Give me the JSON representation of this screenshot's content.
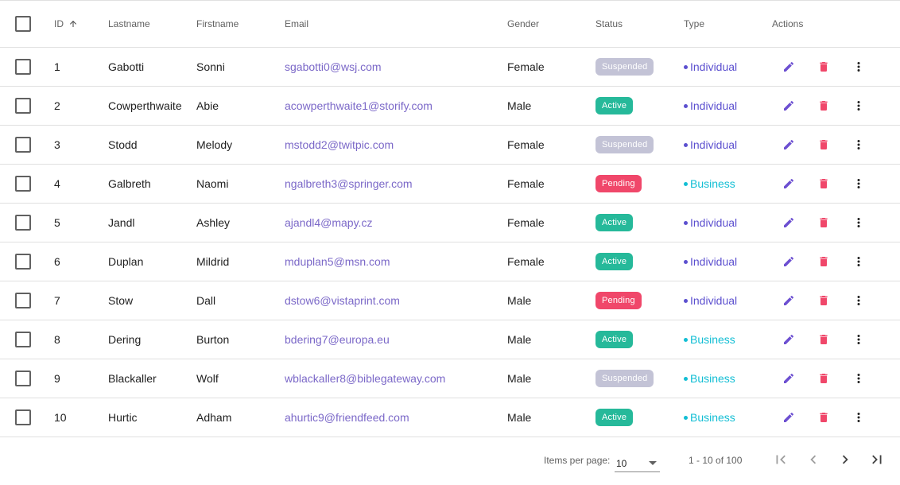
{
  "columns": {
    "id": "ID",
    "lastname": "Lastname",
    "firstname": "Firstname",
    "email": "Email",
    "gender": "Gender",
    "status": "Status",
    "type": "Type",
    "actions": "Actions"
  },
  "sort": {
    "column": "id",
    "direction": "ascending",
    "icon": "arrow-up-icon"
  },
  "rows": [
    {
      "id": "1",
      "lastname": "Gabotti",
      "firstname": "Sonni",
      "email": "sgabotti0@wsj.com",
      "gender": "Female",
      "status": "Suspended",
      "type": "Individual"
    },
    {
      "id": "2",
      "lastname": "Cowperthwaite",
      "firstname": "Abie",
      "email": "acowperthwaite1@storify.com",
      "gender": "Male",
      "status": "Active",
      "type": "Individual"
    },
    {
      "id": "3",
      "lastname": "Stodd",
      "firstname": "Melody",
      "email": "mstodd2@twitpic.com",
      "gender": "Female",
      "status": "Suspended",
      "type": "Individual"
    },
    {
      "id": "4",
      "lastname": "Galbreth",
      "firstname": "Naomi",
      "email": "ngalbreth3@springer.com",
      "gender": "Female",
      "status": "Pending",
      "type": "Business"
    },
    {
      "id": "5",
      "lastname": "Jandl",
      "firstname": "Ashley",
      "email": "ajandl4@mapy.cz",
      "gender": "Female",
      "status": "Active",
      "type": "Individual"
    },
    {
      "id": "6",
      "lastname": "Duplan",
      "firstname": "Mildrid",
      "email": "mduplan5@msn.com",
      "gender": "Female",
      "status": "Active",
      "type": "Individual"
    },
    {
      "id": "7",
      "lastname": "Stow",
      "firstname": "Dall",
      "email": "dstow6@vistaprint.com",
      "gender": "Male",
      "status": "Pending",
      "type": "Individual"
    },
    {
      "id": "8",
      "lastname": "Dering",
      "firstname": "Burton",
      "email": "bdering7@europa.eu",
      "gender": "Male",
      "status": "Active",
      "type": "Business"
    },
    {
      "id": "9",
      "lastname": "Blackaller",
      "firstname": "Wolf",
      "email": "wblackaller8@biblegateway.com",
      "gender": "Male",
      "status": "Suspended",
      "type": "Business"
    },
    {
      "id": "10",
      "lastname": "Hurtic",
      "firstname": "Adham",
      "email": "ahurtic9@friendfeed.com",
      "gender": "Male",
      "status": "Active",
      "type": "Business"
    }
  ],
  "colors": {
    "status": {
      "Suspended": "#c3c3d6",
      "Active": "#26b99a",
      "Pending": "#f0476a"
    },
    "type": {
      "Individual": "#5b4fcf",
      "Business": "#12bed4"
    },
    "email": "#7b68c8",
    "edit_icon": "#6c4fd1",
    "delete_icon": "#f0476a",
    "more_icon": "#212121"
  },
  "row_actions": {
    "edit_icon": "pencil-icon",
    "delete_icon": "trash-icon",
    "more_icon": "more-vertical-icon"
  },
  "paginator": {
    "items_per_page_label": "Items per page:",
    "items_per_page_value": "10",
    "range_label": "1 - 10 of 100",
    "first_icon": "first-page-icon",
    "prev_icon": "chevron-left-icon",
    "next_icon": "chevron-right-icon",
    "last_icon": "last-page-icon"
  }
}
